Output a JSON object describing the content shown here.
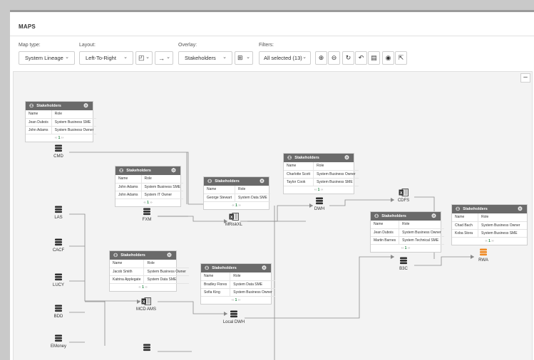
{
  "header": {
    "title": "MAPS"
  },
  "toolbar": {
    "map_type_label": "Map type:",
    "map_type_value": "System Lineage",
    "layout_label": "Layout:",
    "layout_value": "Left-To-Right",
    "overlay_label": "Overlay:",
    "overlay_value": "Stakeholders",
    "filters_label": "Filters:",
    "filters_value": "All selected (13)"
  },
  "canvas": {
    "collapse_label": "–",
    "nodes": [
      {
        "id": "cmd",
        "label": "CMD",
        "icon": "database-icon"
      },
      {
        "id": "fxm",
        "label": "FXM",
        "icon": "database-icon"
      },
      {
        "id": "mrisk",
        "label": "MRiskXL",
        "icon": "excel-icon"
      },
      {
        "id": "dwh",
        "label": "DWH",
        "icon": "database-icon"
      },
      {
        "id": "cdfs",
        "label": "CDFS",
        "icon": "excel-icon"
      },
      {
        "id": "las",
        "label": "LAS",
        "icon": "database-icon"
      },
      {
        "id": "cacf",
        "label": "CACF",
        "icon": "database-icon"
      },
      {
        "id": "lucy",
        "label": "LUCY",
        "icon": "database-icon"
      },
      {
        "id": "bdd",
        "label": "BDD",
        "icon": "database-icon"
      },
      {
        "id": "emoney",
        "label": "EMoney",
        "icon": "database-icon"
      },
      {
        "id": "mcdams",
        "label": "MCD AMS",
        "icon": "excel-icon"
      },
      {
        "id": "localdwh",
        "label": "Local DWH",
        "icon": "database-icon"
      },
      {
        "id": "b3c",
        "label": "B3C",
        "icon": "database-icon"
      },
      {
        "id": "rwa",
        "label": "RWA",
        "icon": "database-icon",
        "color": "#f08a24"
      },
      {
        "id": "extra",
        "label": "",
        "icon": "database-icon"
      }
    ],
    "cards": [
      {
        "id": "card-cmd",
        "title": "Stakeholders",
        "header": [
          "Name",
          "Role"
        ],
        "rows": [
          [
            "Jean Dubois",
            "System Business SME"
          ],
          [
            "John Adams",
            "System Business Owner"
          ]
        ],
        "pager": [
          "‹‹",
          "1",
          "››"
        ]
      },
      {
        "id": "card-fxm",
        "title": "Stakeholders",
        "header": [
          "Name",
          "Role"
        ],
        "rows": [
          [
            "John Adams",
            "System Business SME"
          ],
          [
            "John Adams",
            "System IT Owner"
          ]
        ],
        "pager": [
          "‹‹",
          "1",
          "››"
        ]
      },
      {
        "id": "card-mrisk",
        "title": "Stakeholders",
        "header": [
          "Name",
          "Role"
        ],
        "rows": [
          [
            "George Stewart",
            "System Data SME"
          ]
        ],
        "pager": [
          "‹‹",
          "1",
          "››"
        ]
      },
      {
        "id": "card-dwh",
        "title": "Stakeholders",
        "header": [
          "Name",
          "Role"
        ],
        "rows": [
          [
            "Charlotte Scott",
            "System Business Owner"
          ],
          [
            "Taylor Cook",
            "System Business SME"
          ]
        ],
        "pager": [
          "‹‹",
          "1",
          "››"
        ]
      },
      {
        "id": "card-b3c",
        "title": "Stakeholders",
        "header": [
          "Name",
          "Role"
        ],
        "rows": [
          [
            "Jean Dubois",
            "System Business Owner"
          ],
          [
            "Martin Barnes",
            "System Technical SME"
          ]
        ],
        "pager": [
          "‹‹",
          "1",
          "››"
        ]
      },
      {
        "id": "card-rwa",
        "title": "Stakeholders",
        "header": [
          "Name",
          "Role"
        ],
        "rows": [
          [
            "Chad Bach",
            "System Business Owner"
          ],
          [
            "Koba Stora",
            "System Business SME"
          ]
        ],
        "pager": [
          "‹‹",
          "1",
          "››"
        ]
      },
      {
        "id": "card-mcdams",
        "title": "Stakeholders",
        "header": [
          "Name",
          "Role"
        ],
        "rows": [
          [
            "Jacob Smith",
            "System Business Owner"
          ],
          [
            "Katrina Applegate",
            "System Data SME"
          ]
        ],
        "pager": [
          "‹‹",
          "1",
          "››"
        ]
      },
      {
        "id": "card-localdwh",
        "title": "Stakeholders",
        "header": [
          "Name",
          "Role"
        ],
        "rows": [
          [
            "Bradley Flores",
            "System Data SME"
          ],
          [
            "Sofia King",
            "System Business Owner"
          ]
        ],
        "pager": [
          "‹‹",
          "1",
          "››"
        ]
      }
    ]
  }
}
